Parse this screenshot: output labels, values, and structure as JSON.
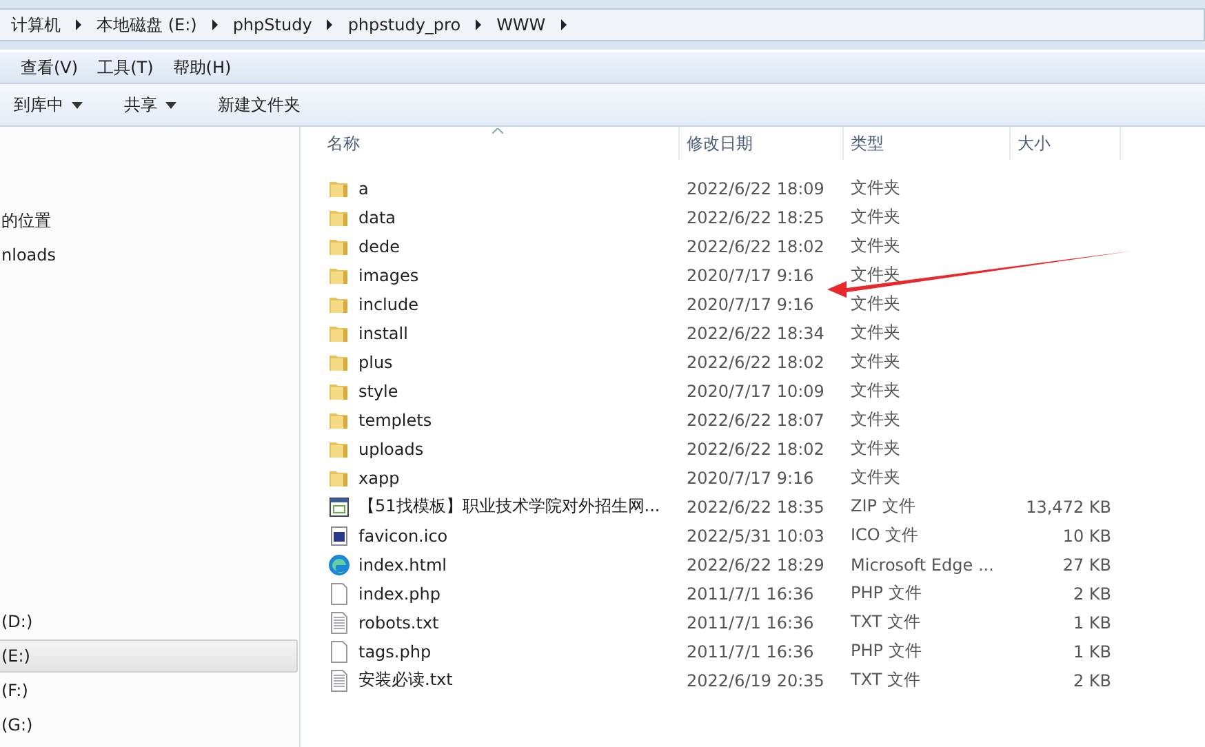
{
  "breadcrumb": [
    "计算机",
    "本地磁盘 (E:)",
    "phpStudy",
    "phpstudy_pro",
    "WWW"
  ],
  "menu": [
    "查看(V)",
    "工具(T)",
    "帮助(H)"
  ],
  "toolbar": [
    {
      "label": "到库中",
      "dropdown": true
    },
    {
      "label": "共享",
      "dropdown": true
    },
    {
      "label": "新建文件夹",
      "dropdown": false
    }
  ],
  "sidebar": {
    "top_items": [
      {
        "label": "的位置",
        "selected": false
      },
      {
        "label": "nloads",
        "selected": false
      }
    ],
    "drives": [
      {
        "label": "(D:)",
        "selected": false
      },
      {
        "label": "(E:)",
        "selected": true
      },
      {
        "label": "(F:)",
        "selected": false
      },
      {
        "label": "(G:)",
        "selected": false
      }
    ]
  },
  "table": {
    "columns": [
      "名称",
      "修改日期",
      "类型",
      "大小"
    ],
    "rows": [
      {
        "kind": "folder",
        "name": "a",
        "date": "2022/6/22 18:09",
        "type": "文件夹"
      },
      {
        "kind": "folder",
        "name": "data",
        "date": "2022/6/22 18:25",
        "type": "文件夹"
      },
      {
        "kind": "folder",
        "name": "dede",
        "date": "2022/6/22 18:02",
        "type": "文件夹"
      },
      {
        "kind": "folder",
        "name": "images",
        "date": "2020/7/17 9:16",
        "type": "文件夹"
      },
      {
        "kind": "folder",
        "name": "include",
        "date": "2020/7/17 9:16",
        "type": "文件夹"
      },
      {
        "kind": "folder",
        "name": "install",
        "date": "2022/6/22 18:34",
        "type": "文件夹"
      },
      {
        "kind": "folder",
        "name": "plus",
        "date": "2022/6/22 18:02",
        "type": "文件夹"
      },
      {
        "kind": "folder",
        "name": "style",
        "date": "2020/7/17 10:09",
        "type": "文件夹"
      },
      {
        "kind": "folder",
        "name": "templets",
        "date": "2022/6/22 18:07",
        "type": "文件夹"
      },
      {
        "kind": "folder",
        "name": "uploads",
        "date": "2022/6/22 18:02",
        "type": "文件夹"
      },
      {
        "kind": "folder",
        "name": "xapp",
        "date": "2020/7/17 9:16",
        "type": "文件夹"
      },
      {
        "kind": "zip",
        "name": "【51找模板】职业技术学院对外招生网...",
        "date": "2022/6/22 18:35",
        "type": "ZIP 文件",
        "size": "13,472 KB"
      },
      {
        "kind": "ico",
        "name": "favicon.ico",
        "date": "2022/5/31 10:03",
        "type": "ICO 文件",
        "size": "10 KB"
      },
      {
        "kind": "edge",
        "name": "index.html",
        "date": "2022/6/22 18:29",
        "type": "Microsoft Edge ...",
        "size": "27 KB"
      },
      {
        "kind": "file",
        "name": "index.php",
        "date": "2011/7/1 16:36",
        "type": "PHP 文件",
        "size": "2 KB"
      },
      {
        "kind": "text",
        "name": "robots.txt",
        "date": "2011/7/1 16:36",
        "type": "TXT 文件",
        "size": "1 KB"
      },
      {
        "kind": "file",
        "name": "tags.php",
        "date": "2011/7/1 16:36",
        "type": "PHP 文件",
        "size": "1 KB"
      },
      {
        "kind": "text",
        "name": "安装必读.txt",
        "date": "2022/6/19 20:35",
        "type": "TXT 文件",
        "size": "2 KB"
      }
    ]
  }
}
